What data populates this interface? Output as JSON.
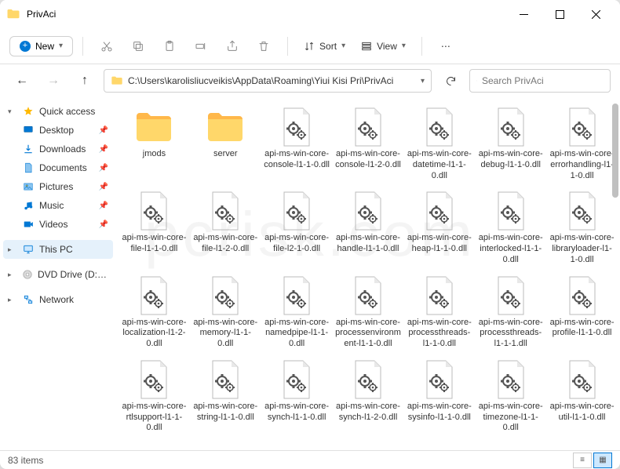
{
  "window": {
    "title": "PrivAci"
  },
  "toolbar": {
    "new_label": "New",
    "sort_label": "Sort",
    "view_label": "View"
  },
  "address": {
    "path": "C:\\Users\\karolisliucveikis\\AppData\\Roaming\\Yiui Kisi Pri\\PrivAci"
  },
  "search": {
    "placeholder": "Search PrivAci"
  },
  "sidebar": {
    "quick_access": "Quick access",
    "items": [
      {
        "label": "Desktop",
        "icon": "desktop"
      },
      {
        "label": "Downloads",
        "icon": "downloads"
      },
      {
        "label": "Documents",
        "icon": "documents"
      },
      {
        "label": "Pictures",
        "icon": "pictures"
      },
      {
        "label": "Music",
        "icon": "music"
      },
      {
        "label": "Videos",
        "icon": "videos"
      }
    ],
    "this_pc": "This PC",
    "dvd": "DVD Drive (D:) CCCC",
    "network": "Network"
  },
  "files": [
    {
      "name": "jmods",
      "type": "folder"
    },
    {
      "name": "server",
      "type": "folder"
    },
    {
      "name": "api-ms-win-core-console-l1-1-0.dll",
      "type": "dll"
    },
    {
      "name": "api-ms-win-core-console-l1-2-0.dll",
      "type": "dll"
    },
    {
      "name": "api-ms-win-core-datetime-l1-1-0.dll",
      "type": "dll"
    },
    {
      "name": "api-ms-win-core-debug-l1-1-0.dll",
      "type": "dll"
    },
    {
      "name": "api-ms-win-core-errorhandling-l1-1-0.dll",
      "type": "dll"
    },
    {
      "name": "api-ms-win-core-file-l1-1-0.dll",
      "type": "dll"
    },
    {
      "name": "api-ms-win-core-file-l1-2-0.dll",
      "type": "dll"
    },
    {
      "name": "api-ms-win-core-file-l2-1-0.dll",
      "type": "dll"
    },
    {
      "name": "api-ms-win-core-handle-l1-1-0.dll",
      "type": "dll"
    },
    {
      "name": "api-ms-win-core-heap-l1-1-0.dll",
      "type": "dll"
    },
    {
      "name": "api-ms-win-core-interlocked-l1-1-0.dll",
      "type": "dll"
    },
    {
      "name": "api-ms-win-core-libraryloader-l1-1-0.dll",
      "type": "dll"
    },
    {
      "name": "api-ms-win-core-localization-l1-2-0.dll",
      "type": "dll"
    },
    {
      "name": "api-ms-win-core-memory-l1-1-0.dll",
      "type": "dll"
    },
    {
      "name": "api-ms-win-core-namedpipe-l1-1-0.dll",
      "type": "dll"
    },
    {
      "name": "api-ms-win-core-processenvironment-l1-1-0.dll",
      "type": "dll"
    },
    {
      "name": "api-ms-win-core-processthreads-l1-1-0.dll",
      "type": "dll"
    },
    {
      "name": "api-ms-win-core-processthreads-l1-1-1.dll",
      "type": "dll"
    },
    {
      "name": "api-ms-win-core-profile-l1-1-0.dll",
      "type": "dll"
    },
    {
      "name": "api-ms-win-core-rtlsupport-l1-1-0.dll",
      "type": "dll"
    },
    {
      "name": "api-ms-win-core-string-l1-1-0.dll",
      "type": "dll"
    },
    {
      "name": "api-ms-win-core-synch-l1-1-0.dll",
      "type": "dll"
    },
    {
      "name": "api-ms-win-core-synch-l1-2-0.dll",
      "type": "dll"
    },
    {
      "name": "api-ms-win-core-sysinfo-l1-1-0.dll",
      "type": "dll"
    },
    {
      "name": "api-ms-win-core-timezone-l1-1-0.dll",
      "type": "dll"
    },
    {
      "name": "api-ms-win-core-util-l1-1-0.dll",
      "type": "dll"
    }
  ],
  "status": {
    "count": "83 items"
  },
  "watermark": "pcrisk.com"
}
